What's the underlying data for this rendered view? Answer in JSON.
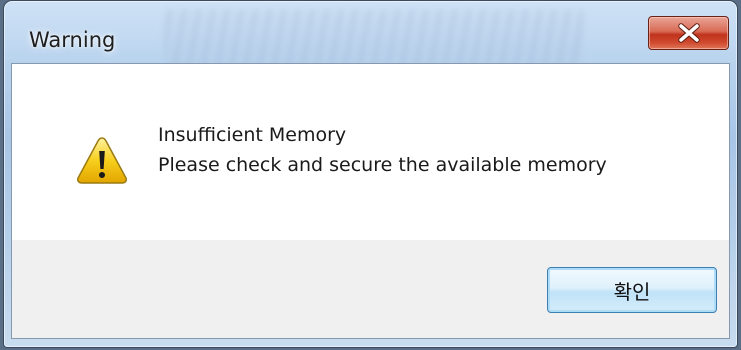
{
  "window": {
    "title": "Warning",
    "close_label": "X"
  },
  "message": {
    "icon": "warning-triangle-icon",
    "line1": "Insufficient Memory",
    "line2": "Please check and secure the available memory"
  },
  "buttons": {
    "ok_label": "확인"
  },
  "colors": {
    "close_button": "#c7402a",
    "ok_button_border": "#3c7fb1",
    "warning_yellow": "#f5c400"
  }
}
